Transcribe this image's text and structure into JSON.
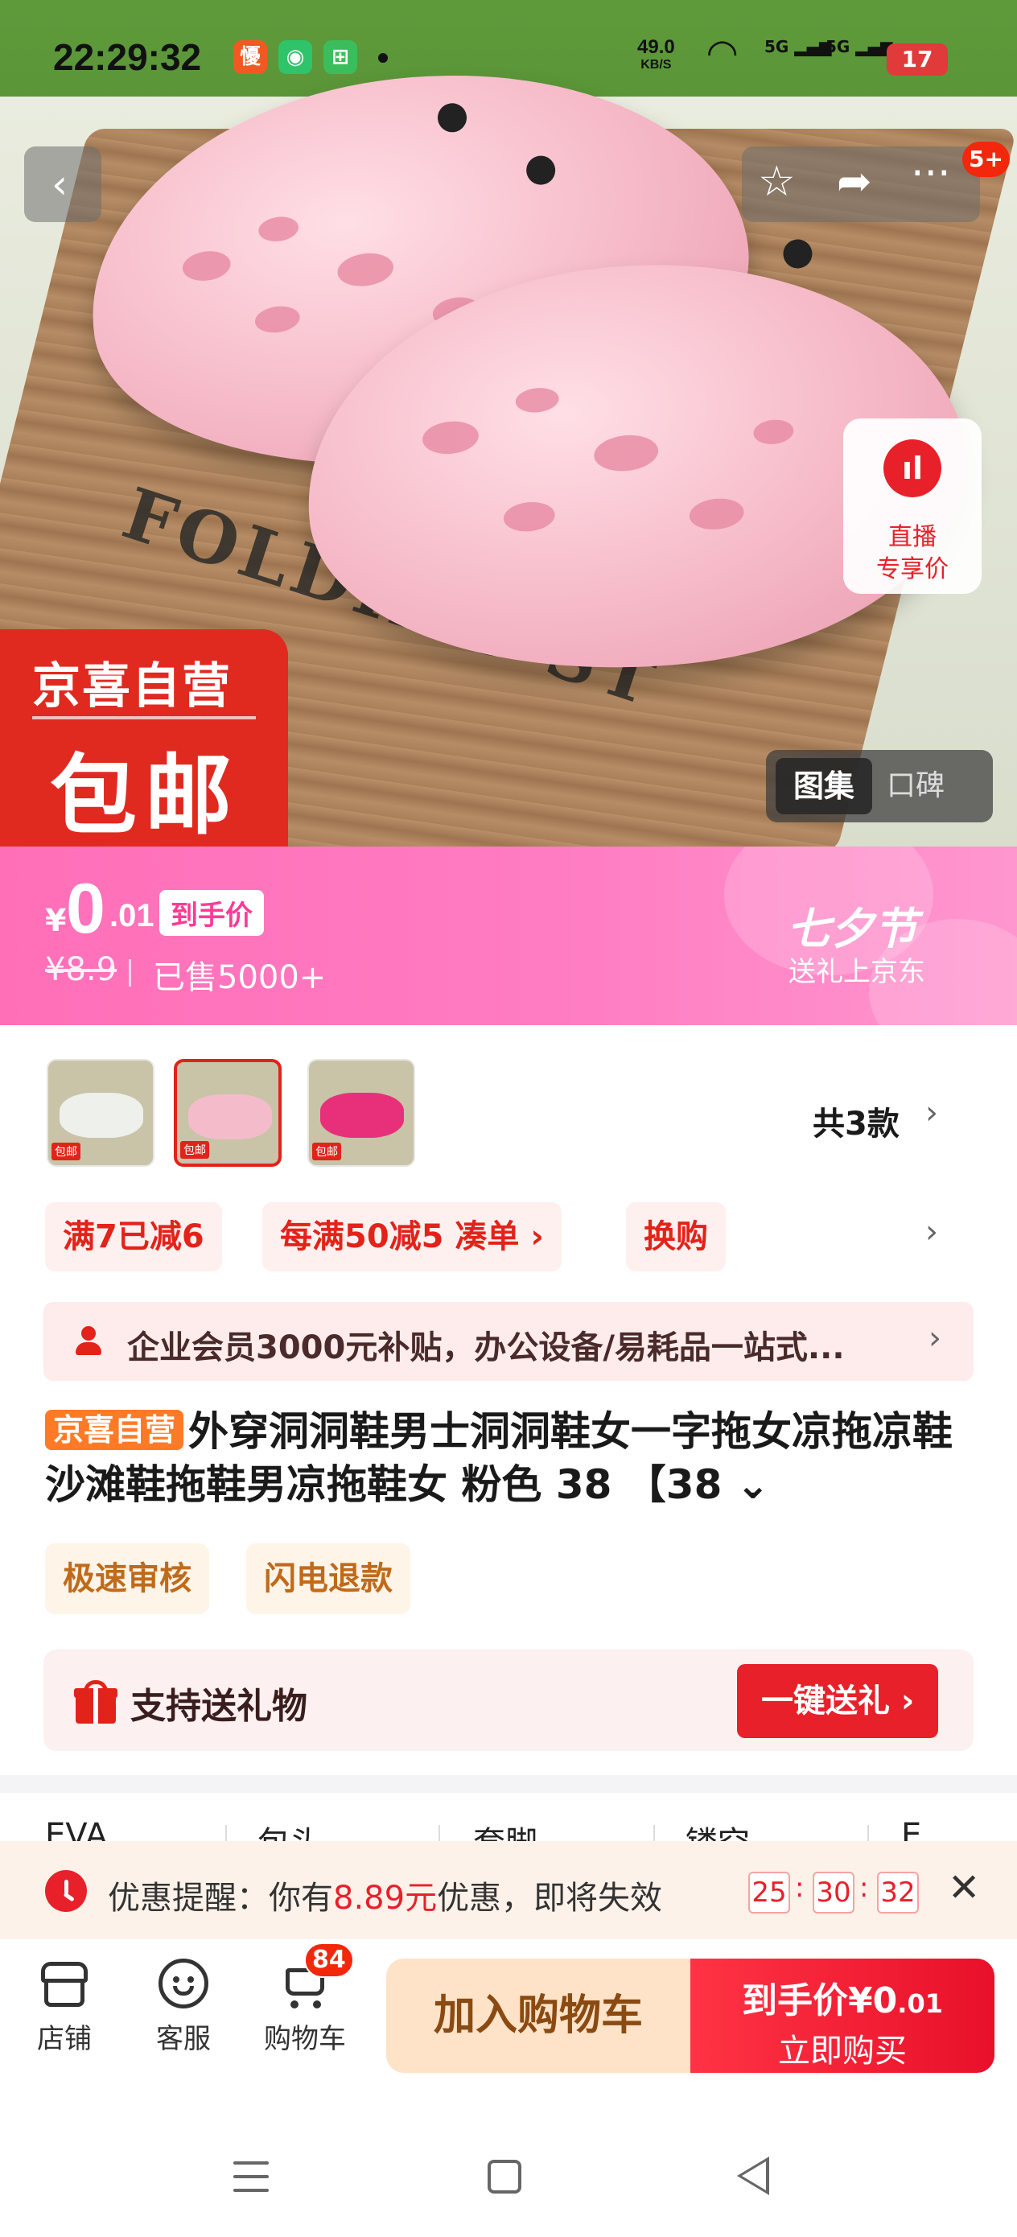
{
  "status_bar": {
    "time": "22:29:32",
    "speed_value": "49.0",
    "speed_unit": "KB/S",
    "signal1": "5G",
    "signal2": "5G",
    "battery": "17"
  },
  "top_bar": {
    "notification_badge": "5+"
  },
  "hero": {
    "box_text": "FOLDING ST",
    "live_line1": "直播",
    "live_line2": "专享价",
    "self_operated_label": "京喜自营",
    "free_shipping_label": "包邮",
    "gallery_tab_active": "图集",
    "gallery_tab_other": "口碑"
  },
  "price": {
    "currency": "¥",
    "integer": "0",
    "decimal": ".01",
    "tag": "到手价",
    "original": "¥8.9",
    "sold": "已售5000+",
    "festival_title": "七夕节",
    "festival_sub": "送礼上京东"
  },
  "variants": {
    "count_label": "共3款",
    "thumbs": [
      {
        "color": "#e9ece8",
        "label": "包邮",
        "selected": false
      },
      {
        "color": "#f4bccb",
        "label": "包邮",
        "selected": true
      },
      {
        "color": "#e8307a",
        "label": "包邮",
        "selected": false
      }
    ]
  },
  "promos": {
    "chips": [
      "满7已减6",
      "每满50减5 凑单 ›",
      "换购"
    ]
  },
  "member_banner": {
    "text": "企业会员3000元补贴，办公设备/易耗品一站式..."
  },
  "product": {
    "badge": "京喜自营",
    "title": "外穿洞洞鞋男士洞洞鞋女一字拖女凉拖凉鞋沙滩鞋拖鞋男凉拖鞋女 粉色 38 【38 ⌄"
  },
  "services": [
    "极速审核",
    "闪电退款"
  ],
  "gift": {
    "text": "支持送礼物",
    "button": "一键送礼 ›"
  },
  "specs": [
    "EVA",
    "包头",
    "套脚",
    "镂空",
    "E"
  ],
  "reminder": {
    "prefix": "优惠提醒：你有",
    "amount": "8.89元",
    "suffix": "优惠，即将失效",
    "hh": "25",
    "mm": "30",
    "ss": "32"
  },
  "bottom_bar": {
    "store": "店铺",
    "service": "客服",
    "cart": "购物车",
    "cart_badge": "84",
    "add_to_cart": "加入购物车",
    "buy_price_label": "到手价",
    "buy_price_currency": "¥",
    "buy_price_int": "0",
    "buy_price_dec": ".01",
    "buy_now": "立即购买"
  },
  "colors": {
    "accent_red": "#e8202a",
    "price_pink": "#ff7cc2",
    "orange_badge": "#ff7a26"
  }
}
